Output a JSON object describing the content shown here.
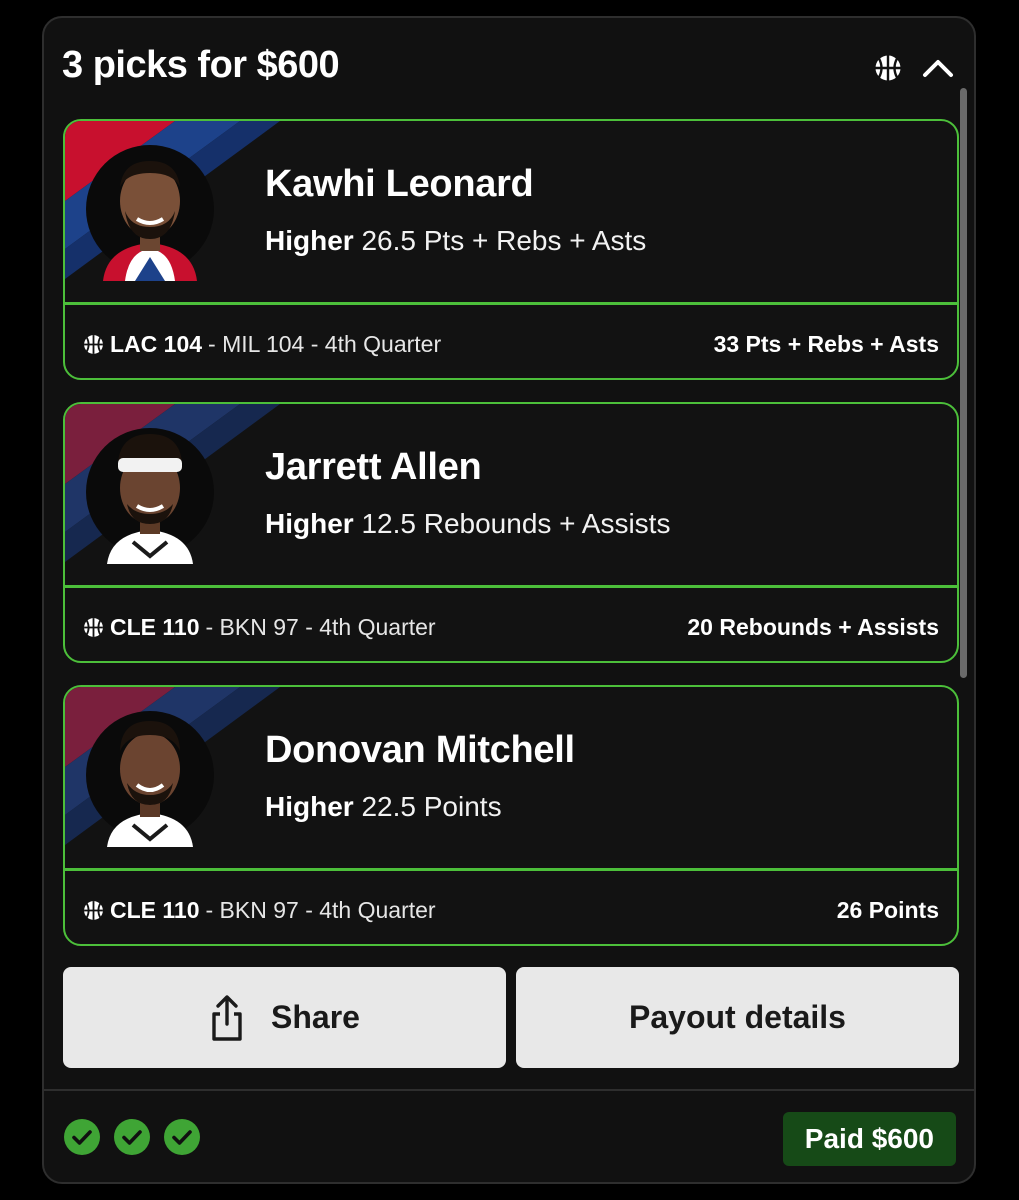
{
  "header": {
    "title": "3 picks for $600"
  },
  "picks": [
    {
      "player": "Kawhi Leonard",
      "direction": "Higher",
      "line": "26.5 Pts + Rebs + Asts",
      "team_score": "LAC 104",
      "rest": "- MIL 104 - 4th Quarter",
      "result": "33 Pts + Rebs + Asts"
    },
    {
      "player": "Jarrett Allen",
      "direction": "Higher",
      "line": "12.5 Rebounds + Assists",
      "team_score": "CLE 110",
      "rest": "- BKN 97 - 4th Quarter",
      "result": "20 Rebounds + Assists"
    },
    {
      "player": "Donovan Mitchell",
      "direction": "Higher",
      "line": "22.5 Points",
      "team_score": "CLE 110",
      "rest": "- BKN 97 - 4th Quarter",
      "result": "26 Points"
    }
  ],
  "buttons": {
    "share_label": "Share",
    "payout_label": "Payout details"
  },
  "footer": {
    "status_label": "Paid $600"
  },
  "icons": {
    "sport": "basketball-icon",
    "collapse": "chevron-up-icon",
    "share": "share-icon",
    "status": "check-circle-icon"
  },
  "colors": {
    "accent_green": "#4cbf3a",
    "paid_badge": "#164a17",
    "card_bg": "#121212",
    "button_bg": "#e8e8e8",
    "jersey_red": "#c8102e",
    "jersey_blue": "#1d428a"
  }
}
